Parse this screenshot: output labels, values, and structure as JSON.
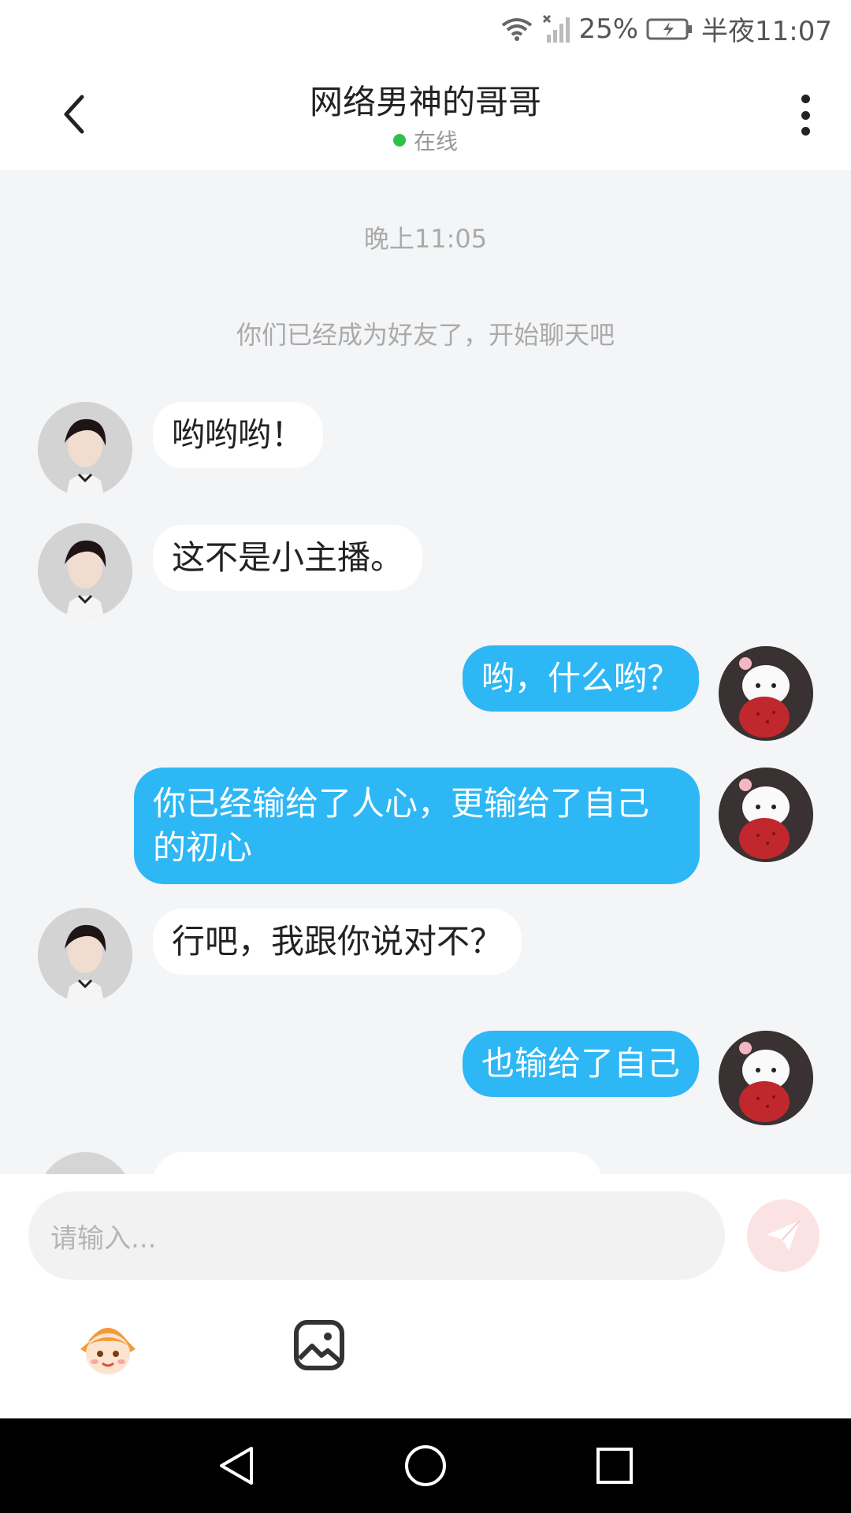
{
  "status_bar": {
    "battery": "25%",
    "time": "半夜11:07",
    "icons": [
      "wifi-icon",
      "signal-icon",
      "battery-icon"
    ]
  },
  "header": {
    "title": "网络男神的哥哥",
    "status": "在线",
    "status_color": "#2fc24a",
    "icons": [
      "back-arrow-icon",
      "more-vertical-icon"
    ]
  },
  "chat": {
    "timestamp": "晚上11:05",
    "system_message": "你们已经成为好友了，开始聊天吧",
    "messages": [
      {
        "from": "other",
        "text": "哟哟哟！"
      },
      {
        "from": "other",
        "text": "这不是小主播。"
      },
      {
        "from": "self",
        "text": "哟，什么哟？"
      },
      {
        "from": "self",
        "text": "你已经输给了人心，更输给了自己的初心"
      },
      {
        "from": "other",
        "text": "行吧，我跟你说对不？"
      },
      {
        "from": "self",
        "text": "也输给了自己"
      }
    ],
    "self_bubble_color": "#2db7f5",
    "other_bubble_color": "#ffffff"
  },
  "input": {
    "placeholder": "请输入...",
    "icons": [
      "send-icon",
      "mascot-icon",
      "image-icon"
    ]
  },
  "nav_bar": {
    "icons": [
      "nav-back-icon",
      "nav-home-icon",
      "nav-recents-icon"
    ]
  }
}
